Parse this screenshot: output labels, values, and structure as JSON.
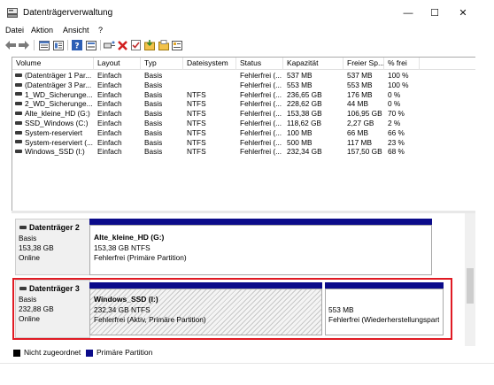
{
  "window": {
    "title": "Datenträgerverwaltung",
    "minimize": "—",
    "maximize": "☐",
    "close": "✕"
  },
  "menu": [
    "Datei",
    "Aktion",
    "Ansicht",
    "?"
  ],
  "toolbar": {
    "icons": [
      "back-icon",
      "forward-icon",
      "list-view-icon",
      "properties-icon",
      "help-icon",
      "disk-icon",
      "connect-icon",
      "delete-icon",
      "check-icon",
      "import-icon",
      "open-folder-icon",
      "settings-icon"
    ]
  },
  "volumes": {
    "columns": [
      "Volume",
      "Layout",
      "Typ",
      "Dateisystem",
      "Status",
      "Kapazität",
      "Freier Sp...",
      "% frei"
    ],
    "rows": [
      [
        "(Datenträger 1 Par...",
        "Einfach",
        "Basis",
        "",
        "Fehlerfrei (...",
        "537 MB",
        "537 MB",
        "100 %"
      ],
      [
        "(Datenträger 3 Par...",
        "Einfach",
        "Basis",
        "",
        "Fehlerfrei (...",
        "553 MB",
        "553 MB",
        "100 %"
      ],
      [
        "1_WD_Sicherunge...",
        "Einfach",
        "Basis",
        "NTFS",
        "Fehlerfrei (...",
        "236,65 GB",
        "176 MB",
        "0 %"
      ],
      [
        "2_WD_Sicherunge...",
        "Einfach",
        "Basis",
        "NTFS",
        "Fehlerfrei (...",
        "228,62 GB",
        "44 MB",
        "0 %"
      ],
      [
        "Alte_kleine_HD (G:)",
        "Einfach",
        "Basis",
        "NTFS",
        "Fehlerfrei (...",
        "153,38 GB",
        "106,95 GB",
        "70 %"
      ],
      [
        "SSD_Windows (C:)",
        "Einfach",
        "Basis",
        "NTFS",
        "Fehlerfrei (...",
        "118,62 GB",
        "2,27 GB",
        "2 %"
      ],
      [
        "System-reserviert",
        "Einfach",
        "Basis",
        "NTFS",
        "Fehlerfrei (...",
        "100 MB",
        "66 MB",
        "66 %"
      ],
      [
        "System-reserviert (...",
        "Einfach",
        "Basis",
        "NTFS",
        "Fehlerfrei (...",
        "500 MB",
        "117 MB",
        "23 %"
      ],
      [
        "Windows_SSD (I:)",
        "Einfach",
        "Basis",
        "NTFS",
        "Fehlerfrei (...",
        "232,34 GB",
        "157,50 GB",
        "68 %"
      ]
    ]
  },
  "disks": [
    {
      "name": "Datenträger 2",
      "type": "Basis",
      "size": "153,38 GB",
      "status": "Online",
      "partitions": [
        {
          "title": "Alte_kleine_HD  (G:)",
          "line1": "153,38 GB NTFS",
          "line2": "Fehlerfrei (Primäre Partition)"
        }
      ]
    },
    {
      "name": "Datenträger 3",
      "type": "Basis",
      "size": "232,88 GB",
      "status": "Online",
      "partitions": [
        {
          "title": "Windows_SSD  (I:)",
          "line1": "232,34 GB NTFS",
          "line2": "Fehlerfrei (Aktiv, Primäre Partition)"
        },
        {
          "title": "",
          "line1": "553 MB",
          "line2": "Fehlerfrei (Wiederherstellungspart"
        }
      ]
    }
  ],
  "legend": [
    {
      "label": "Nicht zugeordnet",
      "color": "#000000"
    },
    {
      "label": "Primäre Partition",
      "color": "#0b0b8a"
    }
  ],
  "colors": {
    "partition_bar": "#0b0b8a",
    "highlight": "#e01b24"
  }
}
